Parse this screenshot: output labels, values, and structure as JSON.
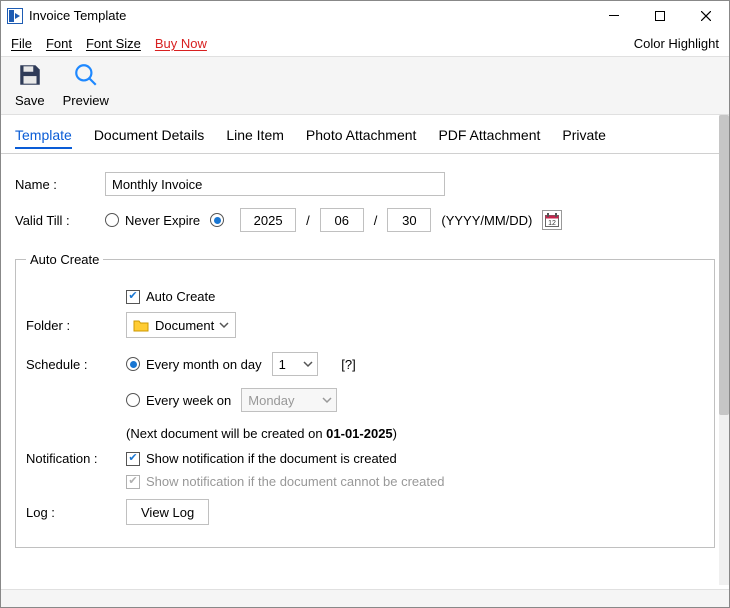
{
  "window": {
    "title": "Invoice Template"
  },
  "menubar": {
    "file": "File",
    "font": "Font",
    "font_size": "Font Size",
    "buy_now": "Buy Now",
    "color_highlight": "Color Highlight"
  },
  "toolbar": {
    "save": "Save",
    "preview": "Preview"
  },
  "tabs": {
    "template": "Template",
    "document_details": "Document Details",
    "line_item": "Line Item",
    "photo_attachment": "Photo Attachment",
    "pdf_attachment": "PDF Attachment",
    "private": "Private"
  },
  "form": {
    "name_label": "Name :",
    "name_value": "Monthly Invoice",
    "valid_till_label": "Valid Till :",
    "never_expire_label": "Never Expire",
    "yyyy": "2025",
    "mm": "06",
    "dd": "30",
    "sep": "/",
    "date_format_hint": "(YYYY/MM/DD)"
  },
  "auto_create": {
    "legend": "Auto Create",
    "enable_label": "Auto Create",
    "folder_label": "Folder :",
    "folder_value": "Document",
    "schedule_label": "Schedule :",
    "monthly_prefix": "Every month on day",
    "monthly_day": "1",
    "help": "[?]",
    "weekly_prefix": "Every week on",
    "weekly_day": "Monday",
    "next_doc_prefix": "(Next document will be created on ",
    "next_doc_date": "01-01-2025",
    "next_doc_suffix": ")",
    "notification_label": "Notification :",
    "notify_success": "Show notification if the document is created",
    "notify_fail": "Show notification if the document cannot be created",
    "log_label": "Log :",
    "view_log": "View Log"
  }
}
